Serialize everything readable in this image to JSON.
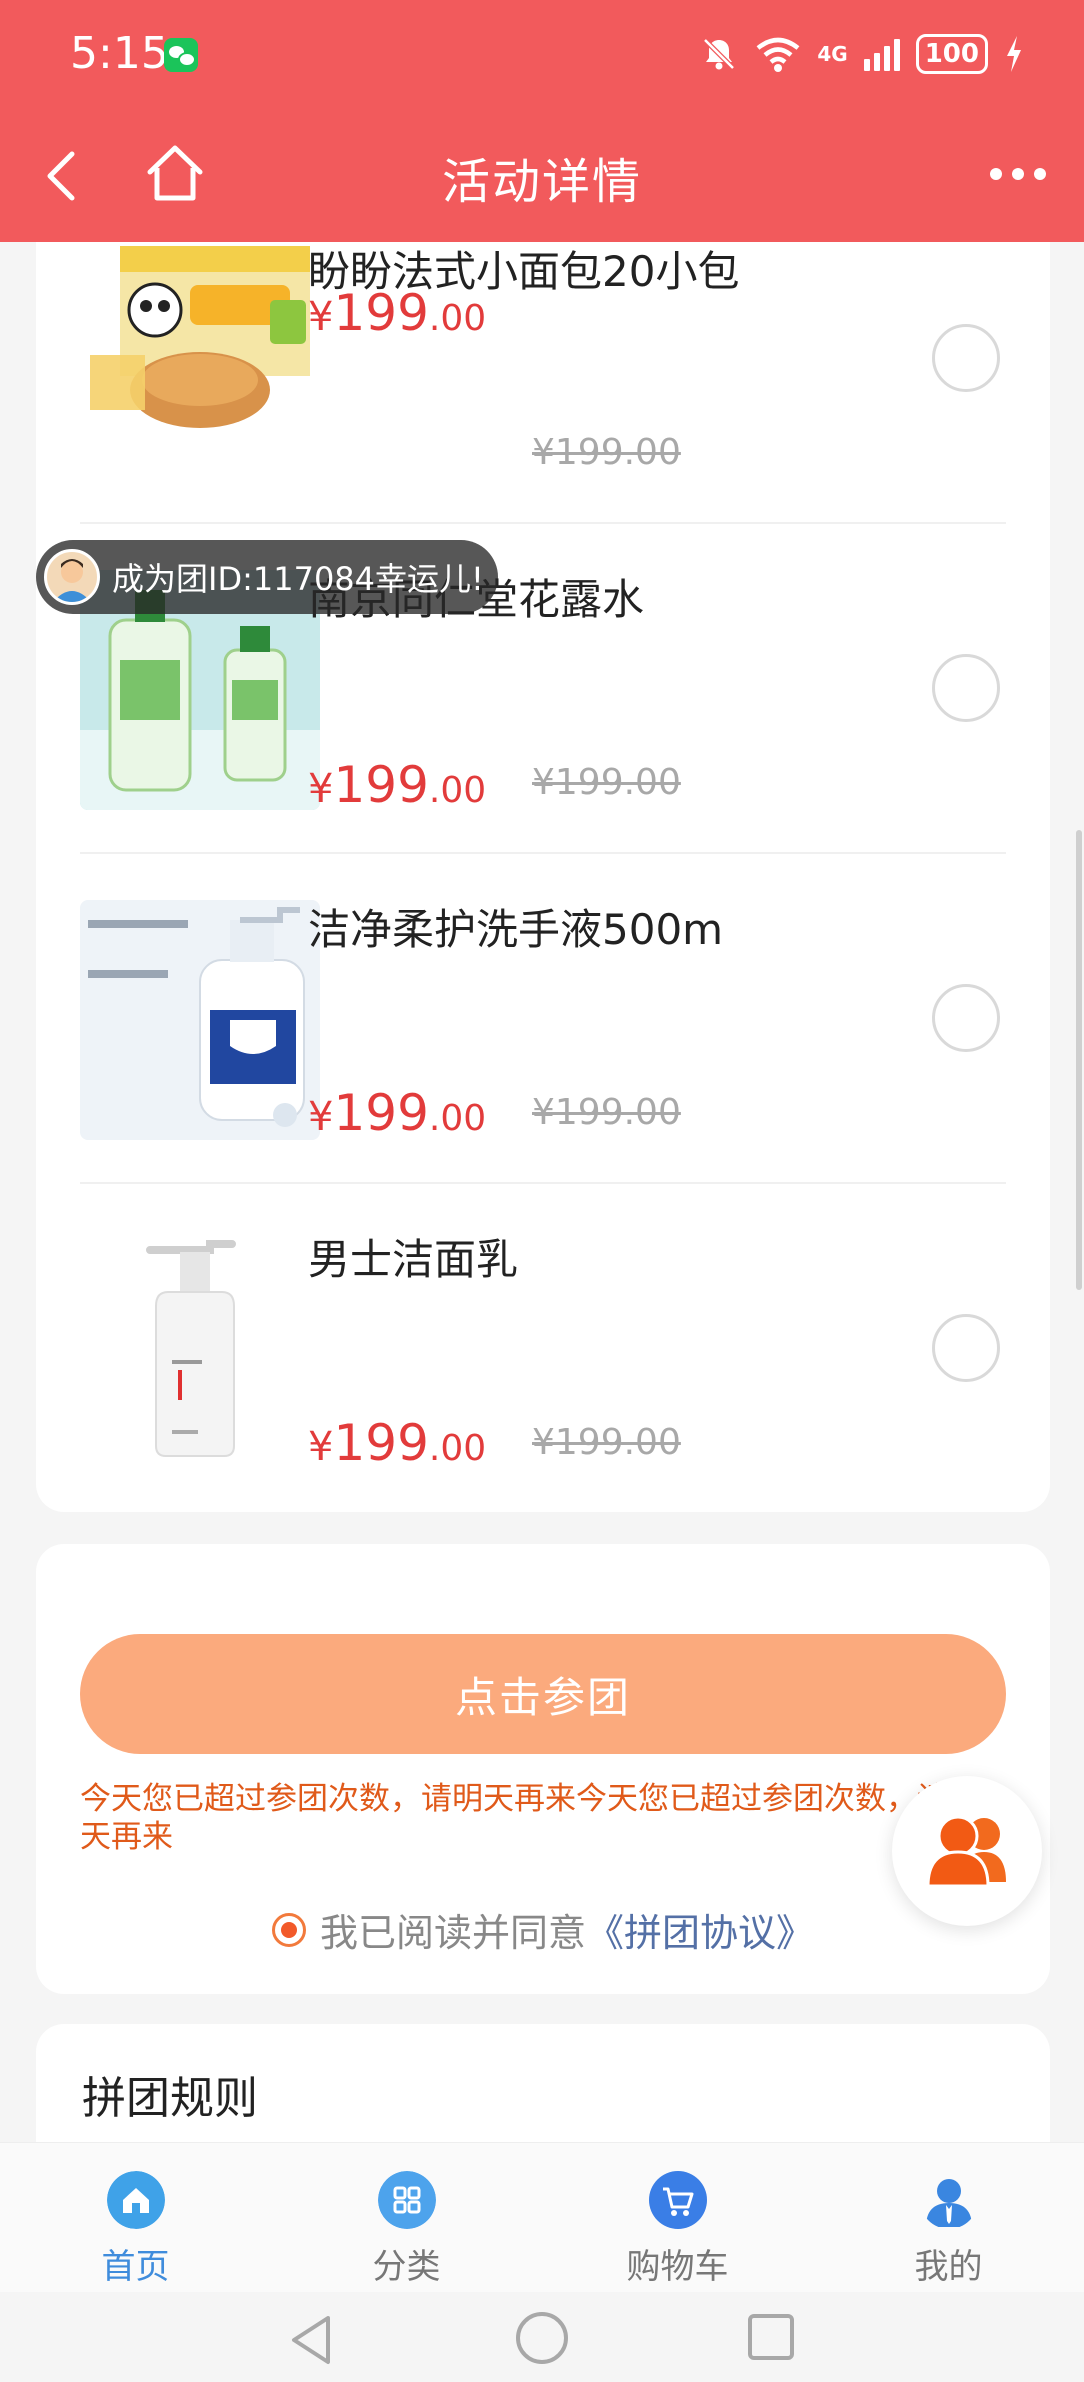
{
  "status_bar": {
    "time": "5:15",
    "network": "4G",
    "battery": "100"
  },
  "header": {
    "title": "活动详情"
  },
  "products": [
    {
      "name": "盼盼法式小面包20小包",
      "price_int": "199",
      "price_dec": ".00",
      "currency": "¥",
      "original_price": "¥199.00",
      "icon": "bread-box-image"
    },
    {
      "name": "南京同仁堂花露水",
      "price_int": "199",
      "price_dec": ".00",
      "currency": "¥",
      "original_price": "¥199.00",
      "icon": "toilet-water-image"
    },
    {
      "name": "洁净柔护洗手液500m",
      "price_int": "199",
      "price_dec": ".00",
      "currency": "¥",
      "original_price": "¥199.00",
      "icon": "hand-wash-image"
    },
    {
      "name": "男士洁面乳",
      "price_int": "199",
      "price_dec": ".00",
      "currency": "¥",
      "original_price": "¥199.00",
      "icon": "face-cleanser-image"
    }
  ],
  "group_toast": {
    "text": "成为团ID:117084幸运儿!"
  },
  "join": {
    "button_label": "点击参团",
    "warning": "今天您已超过参团次数，请明天再来今天您已超过参团次数，请明天再来",
    "agree_text": "我已阅读并同意",
    "agree_link": "《拼团协议》"
  },
  "rules": {
    "title": "拼团规则"
  },
  "tabbar": {
    "items": [
      {
        "label": "首页",
        "icon": "home-icon",
        "active": true
      },
      {
        "label": "分类",
        "icon": "category-icon",
        "active": false
      },
      {
        "label": "购物车",
        "icon": "cart-icon",
        "active": false
      },
      {
        "label": "我的",
        "icon": "profile-icon",
        "active": false
      }
    ]
  },
  "colors": {
    "header_bg": "#f25a5c",
    "price": "#e23b3b",
    "join_button": "#fbaa7d",
    "warning": "#e05a1a",
    "tab_active": "#3f8cdc"
  }
}
